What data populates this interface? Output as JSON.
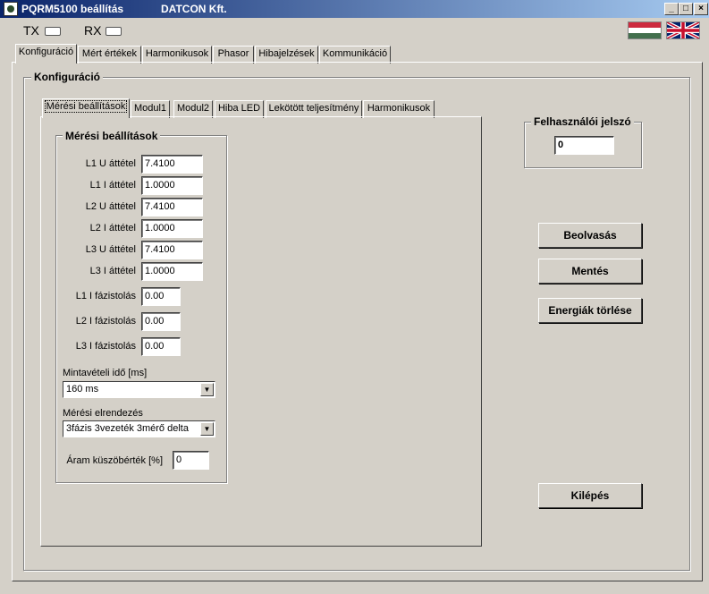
{
  "window": {
    "title": "PQRM5100 beállítás",
    "vendor": "DATCON Kft."
  },
  "indicators": {
    "tx": "TX",
    "rx": "RX"
  },
  "main_tabs": [
    "Konfiguráció",
    "Mért értékek",
    "Harmonikusok",
    "Phasor",
    "Hibajelzések",
    "Kommunikáció"
  ],
  "config_group": {
    "title": "Konfiguráció"
  },
  "sub_tabs": [
    "Mérési beállítások",
    "Modul1",
    "Modul2",
    "Hiba LED",
    "Lekötött teljesítmény",
    "Harmonikusok"
  ],
  "meas": {
    "title": "Mérési beállítások",
    "ratios": [
      {
        "label": "L1 U áttétel",
        "value": "7.4100"
      },
      {
        "label": "L1 I áttétel",
        "value": "1.0000"
      },
      {
        "label": "L2 U áttétel",
        "value": "7.4100"
      },
      {
        "label": "L2 I áttétel",
        "value": "1.0000"
      },
      {
        "label": "L3 U áttétel",
        "value": "7.4100"
      },
      {
        "label": "L3 I áttétel",
        "value": "1.0000"
      }
    ],
    "phase": [
      {
        "label": "L1 I fázistolás",
        "value": "0.00"
      },
      {
        "label": "L2 I fázistolás",
        "value": "0.00"
      },
      {
        "label": "L3 I fázistolás",
        "value": "0.00"
      }
    ],
    "sampling_label": "Mintavételi idő [ms]",
    "sampling_value": "160 ms",
    "arrangement_label": "Mérési elrendezés",
    "arrangement_value": "3fázis 3vezeték 3mérő delta",
    "threshold_label": "Áram küszöbérték [%]",
    "threshold_value": "0"
  },
  "password": {
    "title": "Felhasználói jelszó",
    "value": "0"
  },
  "buttons": {
    "read": "Beolvasás",
    "save": "Mentés",
    "clear_energy": "Energiák törlése",
    "exit": "Kilépés"
  },
  "colors": {
    "title_start": "#0a246a",
    "title_end": "#a6caf0",
    "face": "#d4d0c8"
  }
}
